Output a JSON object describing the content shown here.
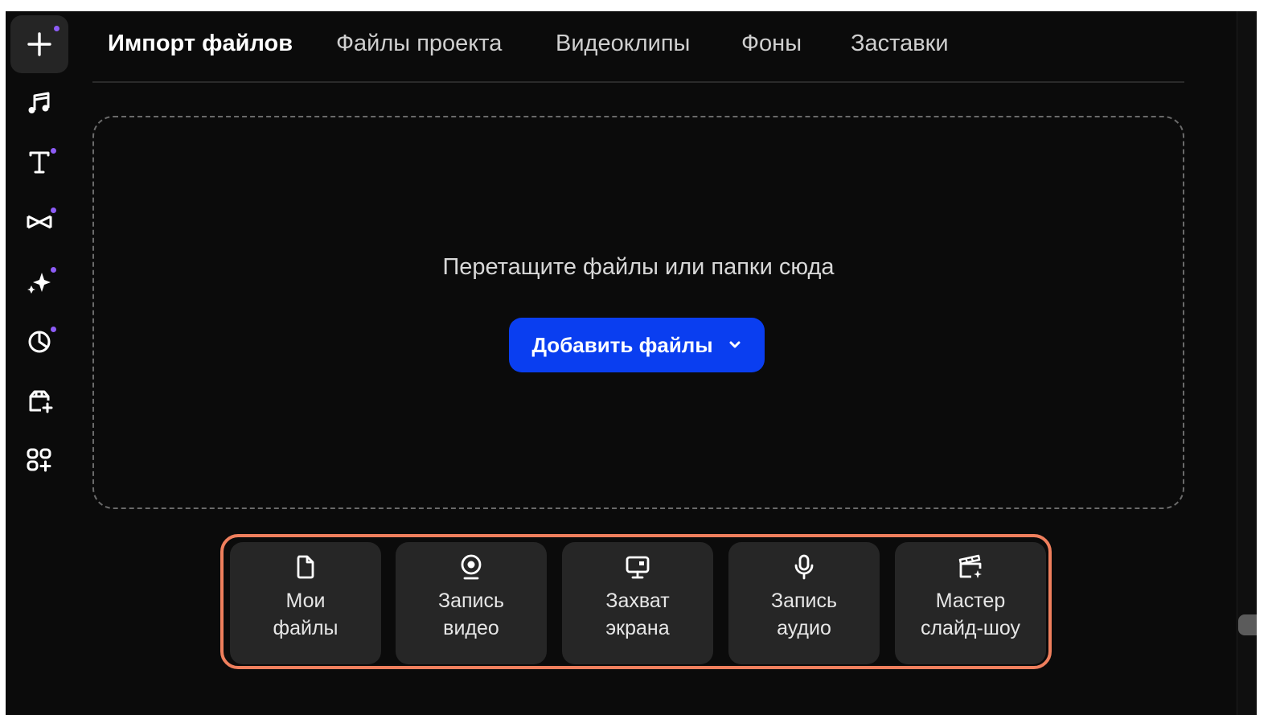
{
  "tabs": [
    {
      "label": "Импорт файлов",
      "active": true
    },
    {
      "label": "Файлы проекта",
      "active": false
    },
    {
      "label": "Видеоклипы",
      "active": false
    },
    {
      "label": "Фоны",
      "active": false
    },
    {
      "label": "Заставки",
      "active": false
    }
  ],
  "sidebar": {
    "items": [
      {
        "icon": "plus-icon",
        "active": true,
        "dot": true
      },
      {
        "icon": "music-icon",
        "active": false,
        "dot": false
      },
      {
        "icon": "text-icon",
        "active": false,
        "dot": true
      },
      {
        "icon": "transition-icon",
        "active": false,
        "dot": true
      },
      {
        "icon": "sparkle-icon",
        "active": false,
        "dot": true
      },
      {
        "icon": "sticker-icon",
        "active": false,
        "dot": true
      },
      {
        "icon": "package-add-icon",
        "active": false,
        "dot": false
      },
      {
        "icon": "apps-add-icon",
        "active": false,
        "dot": false
      }
    ],
    "dot_color": "#8d5cf6"
  },
  "dropzone": {
    "text": "Перетащите файлы или папки сюда",
    "add_button": "Добавить файлы"
  },
  "actions": [
    {
      "icon": "file-icon",
      "label": "Мои\nфайлы"
    },
    {
      "icon": "webcam-icon",
      "label": "Запись\nвидео"
    },
    {
      "icon": "screen-icon",
      "label": "Захват\nэкрана"
    },
    {
      "icon": "microphone-icon",
      "label": "Запись\nаудио"
    },
    {
      "icon": "clapperboard-icon",
      "label": "Мастер\nслайд-шоу"
    }
  ],
  "colors": {
    "accent_button": "#0a3ef0",
    "highlight_frame": "#ef7f5d",
    "background": "#0b0b0b"
  }
}
